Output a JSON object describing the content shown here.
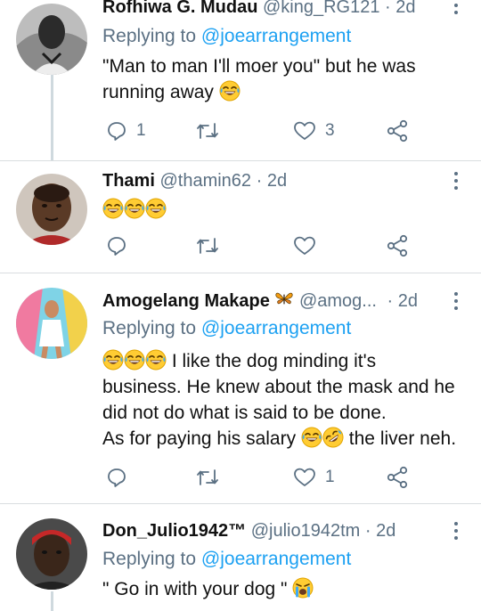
{
  "tweets": [
    {
      "name": "Rofhiwa G. Mudau",
      "handle": "@king_RG121",
      "time": "· 2d",
      "replying_prefix": "Replying to",
      "replying_to": "@joearrangement",
      "text": "\"Man to man I'll moer you\" but he was running away",
      "reply_count": "1",
      "retweet_count": "",
      "like_count": "3"
    },
    {
      "name": "Thami",
      "handle": "@thamin62",
      "time": "· 2d",
      "text": "",
      "reply_count": "",
      "retweet_count": "",
      "like_count": ""
    },
    {
      "name": "Amogelang Makape",
      "handle": "@amog...",
      "time": "· 2d",
      "replying_prefix": "Replying to",
      "replying_to": "@joearrangement",
      "text_lines": [
        "I like the dog minding it's",
        "business. He knew about the mask and he",
        "did not do what is said to be done.",
        "As for paying his salary",
        "the liver neh."
      ],
      "reply_count": "",
      "retweet_count": "",
      "like_count": "1"
    },
    {
      "name": "Don_Julio1942™",
      "handle": "@julio1942tm",
      "time": "· 2d",
      "replying_prefix": "Replying to",
      "replying_to": "@joearrangement",
      "text": "\" Go in with your dog \""
    }
  ],
  "icons": {
    "reply": "reply-icon",
    "retweet": "retweet-icon",
    "like": "heart-icon",
    "share": "share-icon",
    "more": "more-vertical-icon",
    "laugh": "face-with-tears-of-joy-emoji",
    "rofl": "rolling-on-floor-laughing-emoji",
    "cry": "loudly-crying-face-emoji",
    "butterfly": "butterfly-emoji"
  },
  "colors": {
    "link": "#1da1f2",
    "secondary_text": "#5b7083",
    "divider": "#d9dde0",
    "thread_line": "#cfd9de"
  }
}
